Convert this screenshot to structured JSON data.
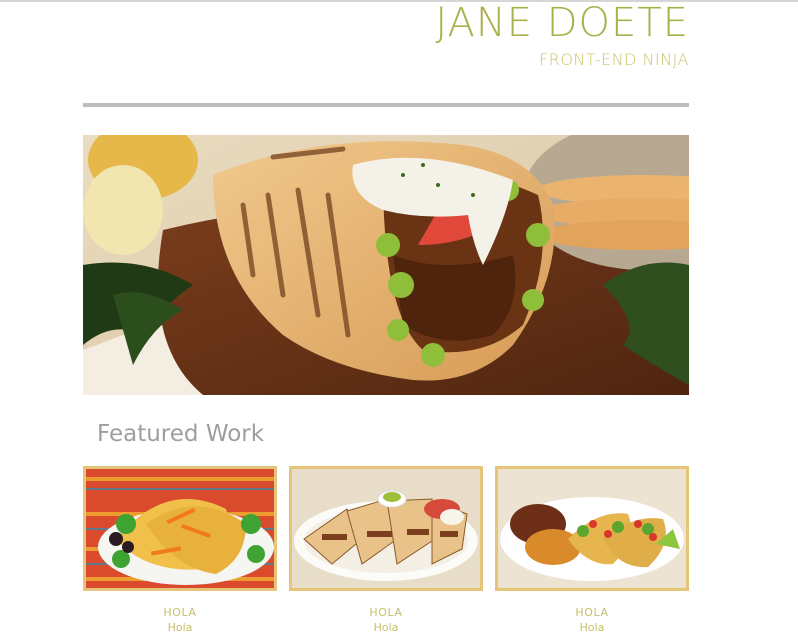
{
  "header": {
    "name": "JANE DOETE",
    "subtitle": "FRONT-END NINJA"
  },
  "hero": {
    "alt": "Gyro wrap with meat, lettuce, tomato and white sauce on a wooden board"
  },
  "featured": {
    "title": "Featured Work",
    "items": [
      {
        "title": "HOLA",
        "subtitle": "Hola",
        "image": "tacos"
      },
      {
        "title": "HOLA",
        "subtitle": "Hola",
        "image": "quesadilla"
      },
      {
        "title": "HOLA",
        "subtitle": "Hola",
        "image": "tacos-with-rice-and-beans"
      }
    ]
  },
  "colors": {
    "name": "#a9b14a",
    "subtitle": "#c9c56a",
    "rule": "#bdbdbd",
    "card_border": "#e6c57a",
    "section_title": "#9e9e9e"
  }
}
